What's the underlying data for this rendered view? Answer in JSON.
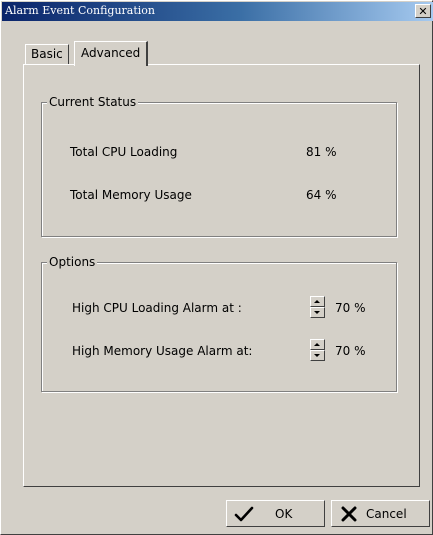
{
  "window": {
    "title": "Alarm Event Configuration",
    "close_symbol": "✕"
  },
  "tabs": [
    {
      "label": "Basic",
      "selected": false
    },
    {
      "label": "Advanced",
      "selected": true
    }
  ],
  "current_status": {
    "group_title": "Current Status",
    "rows": [
      {
        "label": "Total CPU Loading",
        "value": "81 %"
      },
      {
        "label": "Total Memory Usage",
        "value": "64 %"
      }
    ]
  },
  "options": {
    "group_title": "Options",
    "rows": [
      {
        "label": "High CPU Loading Alarm at :",
        "value": "70 %"
      },
      {
        "label": "High Memory Usage Alarm at:",
        "value": "70 %"
      }
    ]
  },
  "buttons": {
    "ok": {
      "label": "OK",
      "icon": "checkmark-icon"
    },
    "cancel": {
      "label": "Cancel",
      "icon": "x-icon"
    }
  },
  "colors": {
    "title_gradient_start": "#0a246a",
    "title_gradient_end": "#a6caf0",
    "face": "#d4d0c8"
  }
}
